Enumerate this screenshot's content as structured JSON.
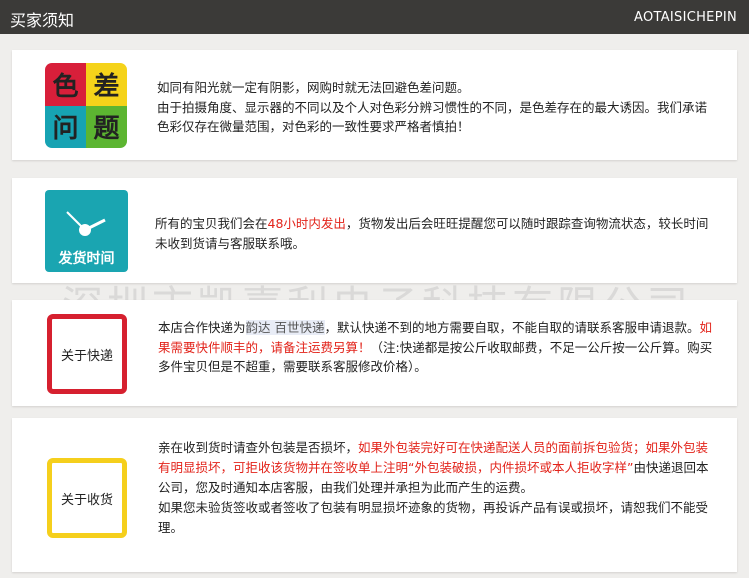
{
  "header": {
    "title": "买家须知",
    "brand": "AOTAISICHEPIN"
  },
  "watermark": "深圳市凯嘉利电子科技有限公司",
  "sections": [
    {
      "icon_chars": [
        "色",
        "差",
        "问",
        "题"
      ],
      "icon_colors": [
        "#d81f3a",
        "#f5d31a",
        "#17a3b3",
        "#5cb531"
      ],
      "lines": [
        "如同有阳光就一定有阴影，网购时就无法回避色差问题。",
        "由于拍摄角度、显示器的不同以及个人对色彩分辨习惯性的不同，是色差存在的最大诱因。我们承诺色彩仅存在微量范围，对色彩的一致性要求严格者慎拍！"
      ]
    },
    {
      "icon_label": "发货时间",
      "text_a": "所有的宝贝我们会在",
      "text_red": "48小时内发出",
      "text_b": "，货物发出后会旺旺提醒您可以随时跟踪查询物流状态，较长时间未收到货请与客服联系哦。"
    },
    {
      "icon_label": "关于快递",
      "text_a": "本店合作快递为",
      "text_hl": "韵达  百世快递",
      "text_b": "，默认快递不到的地方需要自取，不能自取的请联系客服申请退款。",
      "text_red": "如果需要快件顺丰的，请备注运费另算！",
      "text_c": "（注:快递都是按公斤收取邮费，不足一公斤按一公斤算。购买多件宝贝但是不超重，需要联系客服修改价格）。"
    },
    {
      "icon_label": "关于收货",
      "text_a": "亲在收到货时请查外包装是否损坏，",
      "text_red": "如果外包装完好可在快递配送人员的面前拆包验货；如果外包装有明显损坏，可拒收该货物并在签收单上注明“外包装破损，内件损坏或本人拒收字样”",
      "text_b": "由快递退回本公司，您及时通知本店客服，由我们处理并承担为此而产生的运费。",
      "text_c": "如果您未验货签收或者签收了包装有明显损坏迹象的货物，再投诉产品有误或损坏，请恕我们不能受理。"
    }
  ]
}
